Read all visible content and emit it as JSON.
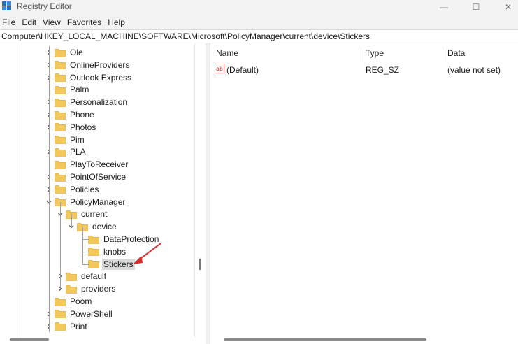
{
  "window": {
    "title": "Registry Editor",
    "controls": {
      "minimize": "—",
      "maximize": "☐",
      "close": "✕"
    }
  },
  "menu": [
    "File",
    "Edit",
    "View",
    "Favorites",
    "Help"
  ],
  "address": "Computer\\HKEY_LOCAL_MACHINE\\SOFTWARE\\Microsoft\\PolicyManager\\current\\device\\Stickers",
  "tree": {
    "items": [
      {
        "label": "Ole",
        "expandable": true,
        "expanded": false,
        "level": 0
      },
      {
        "label": "OnlineProviders",
        "expandable": true,
        "expanded": false,
        "level": 0
      },
      {
        "label": "Outlook Express",
        "expandable": true,
        "expanded": false,
        "level": 0
      },
      {
        "label": "Palm",
        "expandable": false,
        "expanded": false,
        "level": 0
      },
      {
        "label": "Personalization",
        "expandable": true,
        "expanded": false,
        "level": 0
      },
      {
        "label": "Phone",
        "expandable": true,
        "expanded": false,
        "level": 0
      },
      {
        "label": "Photos",
        "expandable": true,
        "expanded": false,
        "level": 0
      },
      {
        "label": "Pim",
        "expandable": false,
        "expanded": false,
        "level": 0
      },
      {
        "label": "PLA",
        "expandable": true,
        "expanded": false,
        "level": 0
      },
      {
        "label": "PlayToReceiver",
        "expandable": false,
        "expanded": false,
        "level": 0
      },
      {
        "label": "PointOfService",
        "expandable": true,
        "expanded": false,
        "level": 0
      },
      {
        "label": "Policies",
        "expandable": true,
        "expanded": false,
        "level": 0
      },
      {
        "label": "PolicyManager",
        "expandable": true,
        "expanded": true,
        "level": 0
      },
      {
        "label": "current",
        "expandable": true,
        "expanded": true,
        "level": 1
      },
      {
        "label": "device",
        "expandable": true,
        "expanded": true,
        "level": 2
      },
      {
        "label": "DataProtection",
        "expandable": false,
        "expanded": false,
        "level": 3
      },
      {
        "label": "knobs",
        "expandable": false,
        "expanded": false,
        "level": 3
      },
      {
        "label": "Stickers",
        "expandable": false,
        "expanded": false,
        "level": 3,
        "selected": true
      },
      {
        "label": "default",
        "expandable": true,
        "expanded": false,
        "level": 1
      },
      {
        "label": "providers",
        "expandable": true,
        "expanded": false,
        "level": 1
      },
      {
        "label": "Poom",
        "expandable": false,
        "expanded": false,
        "level": 0
      },
      {
        "label": "PowerShell",
        "expandable": true,
        "expanded": false,
        "level": 0
      },
      {
        "label": "Print",
        "expandable": true,
        "expanded": false,
        "level": 0
      }
    ]
  },
  "list": {
    "columns": {
      "name": "Name",
      "type": "Type",
      "data": "Data"
    },
    "rows": [
      {
        "icon": "string-value-icon",
        "name": "(Default)",
        "type": "REG_SZ",
        "data": "(value not set)"
      }
    ]
  },
  "colors": {
    "folder": "#f2c75c",
    "folder_dark": "#d9a93a",
    "selection": "#d9d9d9",
    "annotation_arrow": "#d62b2b",
    "app_icon": "#1f6fbf"
  }
}
